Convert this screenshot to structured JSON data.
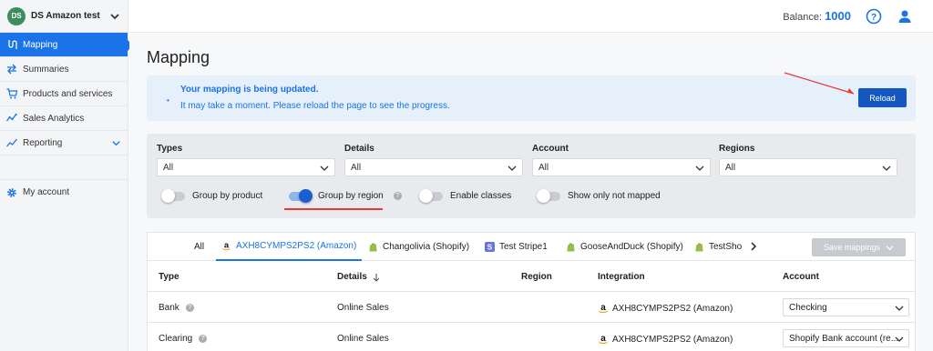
{
  "sidebar": {
    "account": {
      "initials": "DS",
      "name": "DS Amazon test"
    },
    "items": [
      {
        "label": "Mapping",
        "icon": "mapping-icon",
        "active": true
      },
      {
        "label": "Summaries",
        "icon": "arrows-icon"
      },
      {
        "label": "Products and services",
        "icon": "cart-icon"
      },
      {
        "label": "Sales Analytics",
        "icon": "analytics-icon"
      },
      {
        "label": "Reporting",
        "icon": "reporting-icon"
      }
    ],
    "my_account": "My account"
  },
  "topbar": {
    "balance_label": "Balance:",
    "balance_value": "1000"
  },
  "page": {
    "title": "Mapping"
  },
  "banner": {
    "title": "Your mapping is being updated.",
    "text": "It may take a moment. Please reload the page to see the progress.",
    "reload": "Reload"
  },
  "filters": {
    "types": {
      "label": "Types",
      "value": "All"
    },
    "details": {
      "label": "Details",
      "value": "All"
    },
    "account": {
      "label": "Account",
      "value": "All"
    },
    "regions": {
      "label": "Regions",
      "value": "All"
    },
    "toggles": [
      {
        "label": "Group by product",
        "on": false
      },
      {
        "label": "Group by region",
        "on": true
      },
      {
        "label": "Enable classes",
        "on": false
      },
      {
        "label": "Show only not mapped",
        "on": false
      }
    ]
  },
  "tabs": [
    {
      "label": "All"
    },
    {
      "label": "AXH8CYMPS2PS2 (Amazon)",
      "icon": "amazon-icon",
      "active": true
    },
    {
      "label": "Changolivia (Shopify)",
      "icon": "shopify-icon"
    },
    {
      "label": "Test Stripe1",
      "icon": "stripe-icon"
    },
    {
      "label": "GooseAndDuck (Shopify)",
      "icon": "shopify-icon"
    },
    {
      "label": "TestSho",
      "icon": "shopify-icon"
    }
  ],
  "save_mappings": "Save mappings",
  "table": {
    "headers": {
      "type": "Type",
      "details": "Details",
      "region": "Region",
      "integration": "Integration",
      "account": "Account"
    },
    "rows": [
      {
        "type": "Bank",
        "details": "Online Sales",
        "region": "",
        "integration": "AXH8CYMPS2PS2 (Amazon)",
        "account": "Checking"
      },
      {
        "type": "Clearing",
        "details": "Online Sales",
        "region": "",
        "integration": "AXH8CYMPS2PS2 (Amazon)",
        "account": "Shopify Bank account (re..."
      }
    ]
  },
  "colors": {
    "accent": "#1a73e8",
    "annotation": "#e53935"
  }
}
